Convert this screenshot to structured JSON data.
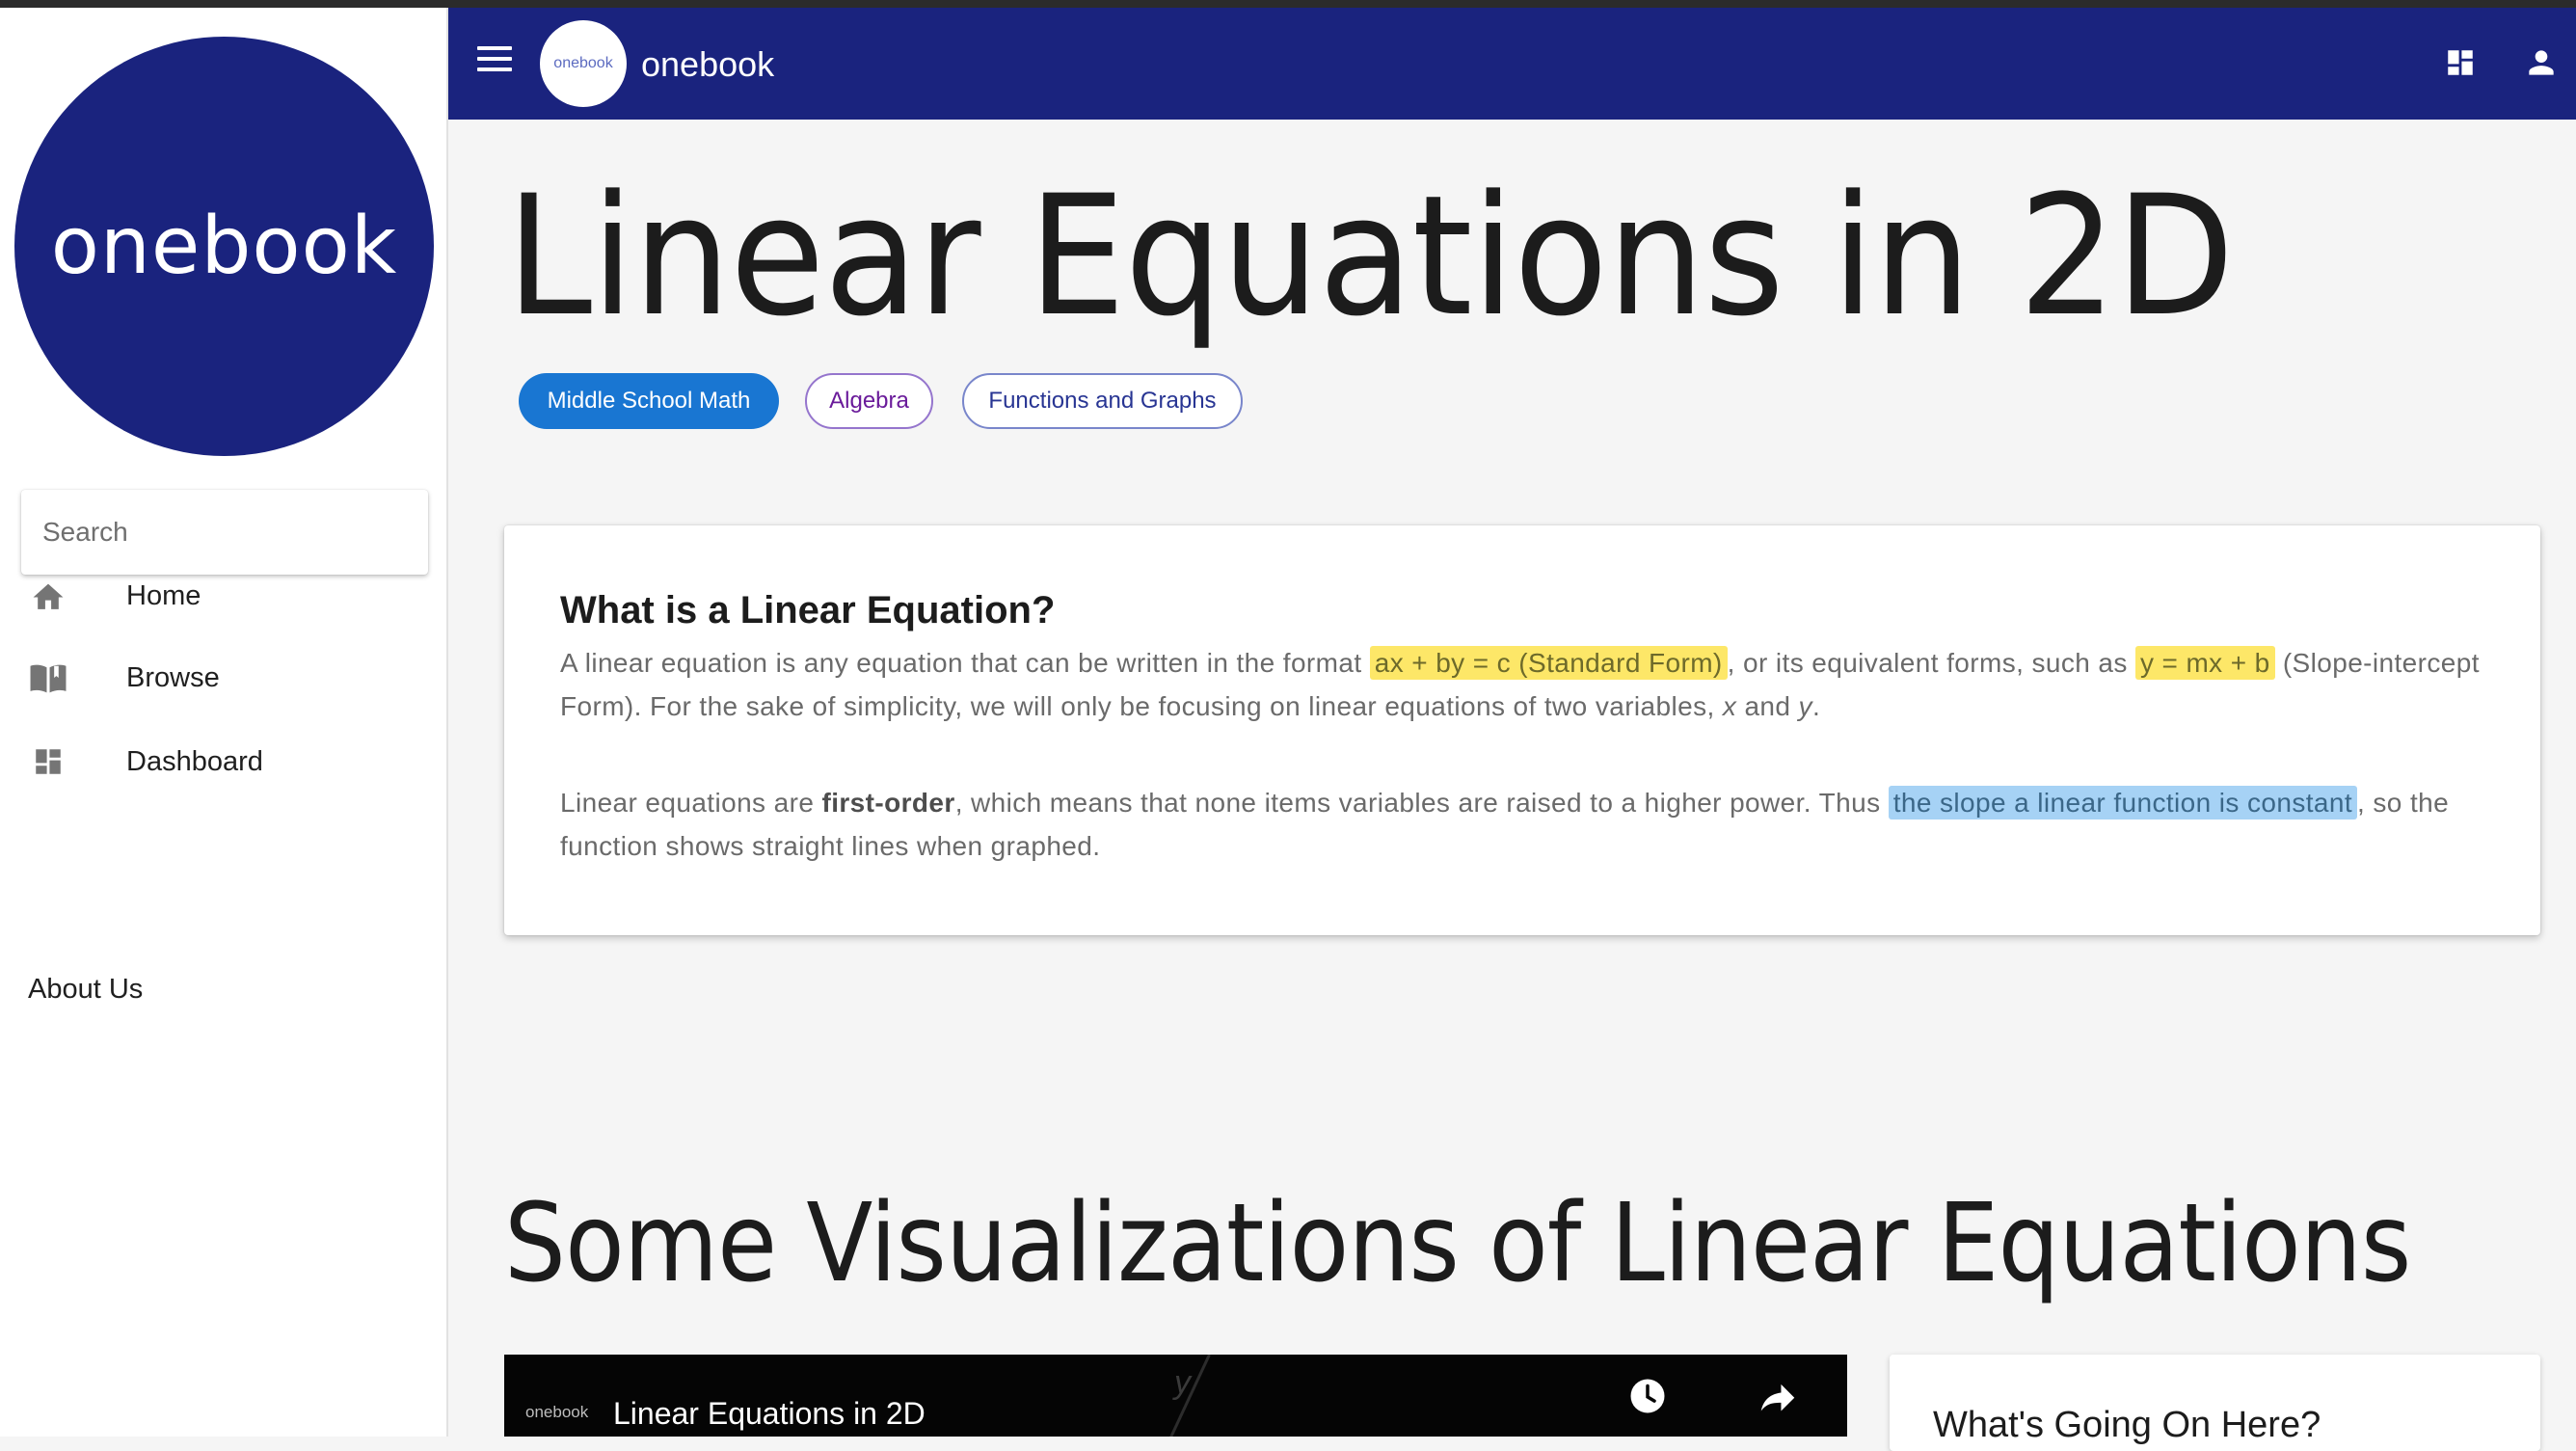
{
  "sidebar": {
    "logo_text": "onebook",
    "search": {
      "placeholder": "Search",
      "value": ""
    },
    "nav": [
      {
        "label": "Home",
        "icon": "home-icon"
      },
      {
        "label": "Browse",
        "icon": "book-open-icon"
      },
      {
        "label": "Dashboard",
        "icon": "dashboard-icon"
      }
    ],
    "about_label": "About Us"
  },
  "appbar": {
    "logo_text": "onebook",
    "title": "onebook",
    "icons": [
      "menu-icon",
      "dashboard-icon",
      "person-icon"
    ]
  },
  "page": {
    "title": "Linear Equations in 2D",
    "tags": [
      "Middle School Math",
      "Algebra",
      "Functions and Graphs"
    ]
  },
  "card": {
    "title": "What is a Linear Equation?",
    "p1_before": "A linear equation is any equation that can be written in the format ",
    "p1_hl1": "ax + by = c (Standard Form)",
    "p1_mid": ", or its equivalent forms, such as ",
    "p1_hl2": "y = mx + b",
    "p1_after": " (Slope-intercept Form). For the sake of simplicity, we will only be focusing on linear equations of two variables, ",
    "p1_var_x": "x",
    "p1_and": " and ",
    "p1_var_y": "y",
    "p1_end": ".",
    "p2_before": "Linear equations are ",
    "p2_bold": "first-order",
    "p2_mid": ", which means that none items variables are raised to a higher power. Thus ",
    "p2_hl": "the slope a linear function is constant",
    "p2_after": ", so the function shows straight lines when graphed."
  },
  "section": {
    "title": "Some Visualizations of Linear Equations"
  },
  "video": {
    "channel": "onebook",
    "title": "Linear Equations in 2D",
    "axis_label": "y"
  },
  "side_card": {
    "title": "What's Going On Here?"
  },
  "colors": {
    "primary": "#1a237e",
    "chip_blue": "#1976d2",
    "highlight_yellow": "#fde768",
    "highlight_blue": "#a6d2f5"
  }
}
